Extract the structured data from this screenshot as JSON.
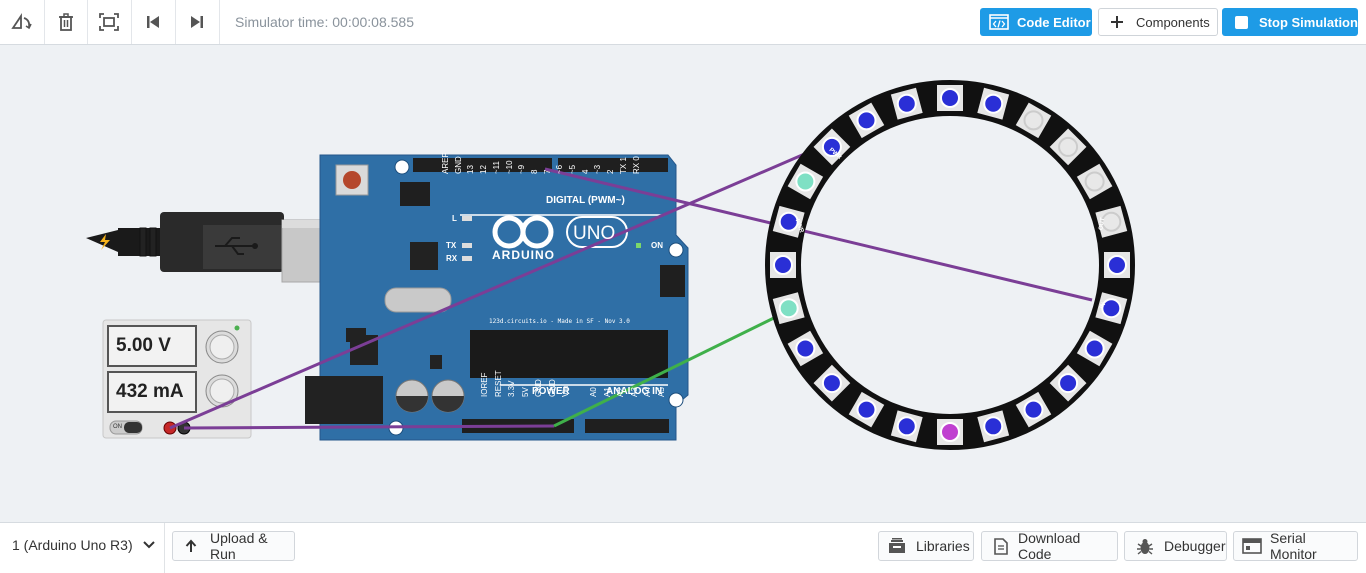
{
  "toolbar": {
    "sim_time": "Simulator time: 00:00:08.585",
    "code_editor": "Code Editor",
    "components": "Components",
    "stop": "Stop Simulation",
    "icons": [
      "rotate-icon",
      "trash-icon",
      "fit-view-icon",
      "step-back-icon",
      "step-forward-icon"
    ]
  },
  "power_supply": {
    "voltage": "5.00 V",
    "current": "432 mA",
    "switch": "ON"
  },
  "arduino": {
    "brand": "ARDUINO",
    "model": "UNO",
    "digital_label": "DIGITAL (PWM~)",
    "power_label": "POWER",
    "analog_label": "ANALOG IN",
    "on_label": "ON",
    "footer": "123d.circuits.io - Made in SF - Nov 3.0",
    "tx": "TX",
    "rx": "RX",
    "l": "L",
    "digital_pins": [
      "AREF",
      "GND",
      "13",
      "12",
      "~11",
      "~10",
      "~9",
      "8",
      "7",
      "~6",
      "~5",
      "4",
      "~3",
      "2",
      "TX 1",
      "RX 0"
    ],
    "power_pins": [
      "IOREF",
      "RESET",
      "3.3V",
      "5V",
      "GND",
      "GND",
      "Vin"
    ],
    "analog_pins": [
      "A0",
      "A1",
      "A2",
      "A3",
      "A4",
      "A5"
    ]
  },
  "ring": {
    "pwr_label": "PWR",
    "in_label": "IN",
    "out_label": "OUT",
    "led_count": 24
  },
  "bottom": {
    "board_select": "1 (Arduino Uno R3)",
    "upload": "Upload & Run",
    "libraries": "Libraries",
    "download": "Download Code",
    "debugger": "Debugger",
    "serial": "Serial Monitor"
  },
  "colors": {
    "accent": "#1e9be6",
    "board": "#2f6fa6",
    "wire_purple": "#7b3e96",
    "wire_green": "#3fb04a",
    "led_blue": "#2a2fd6"
  }
}
